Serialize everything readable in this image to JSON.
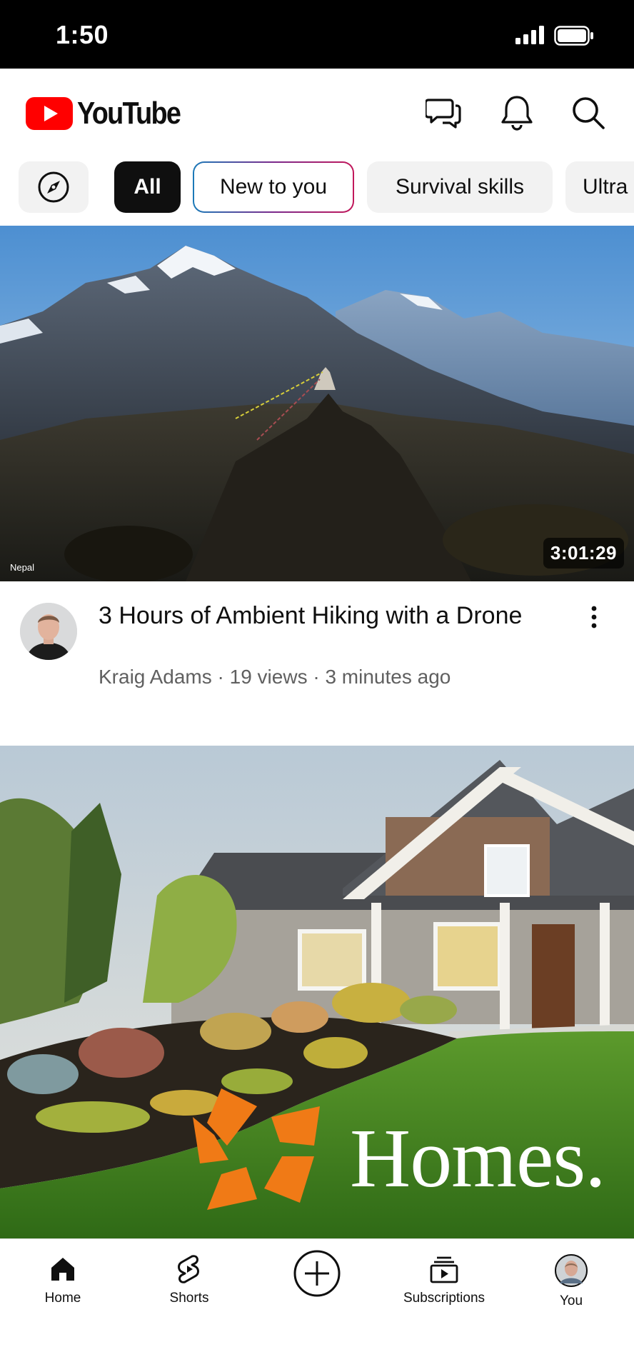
{
  "status_bar": {
    "time": "1:50"
  },
  "app": {
    "logo_text": "YouTube",
    "brand_color": "#ff0000"
  },
  "header": {
    "icons": [
      "chat-icon",
      "bell-icon",
      "search-icon"
    ]
  },
  "chips": [
    {
      "icon": "compass-icon"
    },
    {
      "label": "All",
      "selected": true
    },
    {
      "label": "New to you"
    },
    {
      "label": "Survival skills"
    },
    {
      "label": "Ultra"
    }
  ],
  "videos": [
    {
      "thumbnail_caption": "Nepal",
      "duration": "3:01:29",
      "title": "3 Hours of Ambient Hiking with a Drone",
      "channel": "Kraig Adams",
      "views": "19 views",
      "age": "3 minutes ago",
      "subtitle": "Kraig Adams · 19 views · 3 minutes ago"
    },
    {
      "thumbnail_text": "Homes."
    }
  ],
  "tab_bar": [
    {
      "label": "Home",
      "icon": "home-icon",
      "active": true
    },
    {
      "label": "Shorts",
      "icon": "shorts-icon"
    },
    {
      "label": "",
      "icon": "create-plus-icon"
    },
    {
      "label": "Subscriptions",
      "icon": "subscriptions-icon"
    },
    {
      "label": "You",
      "icon": "avatar"
    }
  ]
}
